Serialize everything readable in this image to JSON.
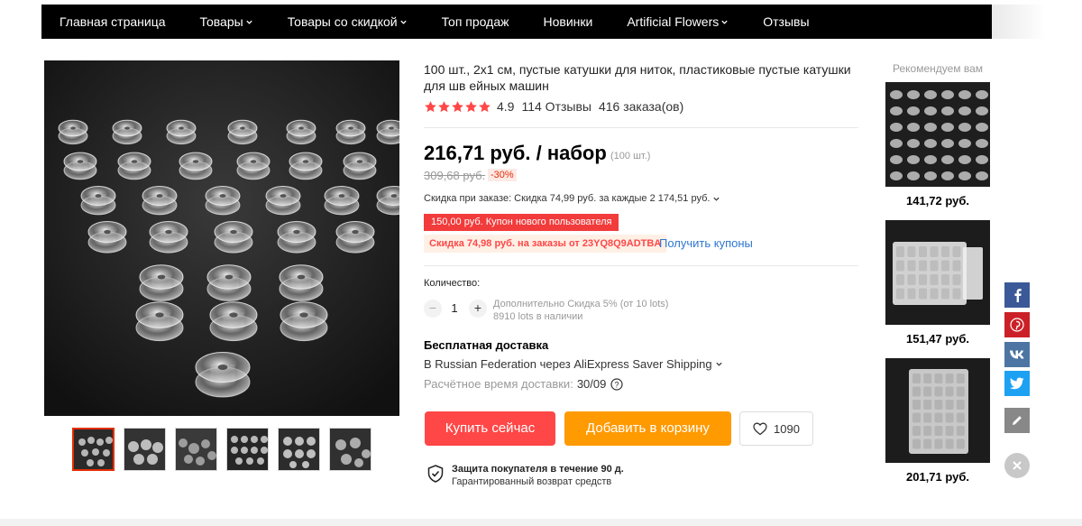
{
  "nav": {
    "items": [
      {
        "label": "Главная страница",
        "has_menu": false
      },
      {
        "label": "Товары",
        "has_menu": true
      },
      {
        "label": "Товары со скидкой",
        "has_menu": true
      },
      {
        "label": "Топ продаж",
        "has_menu": false
      },
      {
        "label": "Новинки",
        "has_menu": false
      },
      {
        "label": "Artificial Flowers",
        "has_menu": true
      },
      {
        "label": "Отзывы",
        "has_menu": false
      }
    ]
  },
  "gallery": {
    "main_alt": "clear-plastic-bobbins",
    "thumbnail_count": 6,
    "active_thumbnail": 1
  },
  "product": {
    "title": "100 шт., 2x1 см, пустые катушки для ниток, пластиковые пустые катушки для шв ейных машин",
    "rating": {
      "stars": 5,
      "score": "4.9",
      "reviews": "114 Отзывы",
      "orders": "416 заказа(ов)"
    },
    "price": "216,71 руб. / набор",
    "unit_note": "(100 шт.)",
    "old_price": "309,68 руб.",
    "discount": "-30%",
    "bulk_discount": "Скидка при заказе: Скидка 74,99 руб. за каждые 2 174,51 руб.",
    "coupon_new_user": "150,00 руб. Купон нового пользователя",
    "coupon_code": "Скидка 74,98 руб. на заказы от 23YQ8Q9ADTBA",
    "get_coupons": "Получить купоны",
    "quantity": {
      "label": "Количество:",
      "minus": "−",
      "value": "1",
      "plus": "+",
      "extra_line1": "Дополнительно Скидка 5% (от 10 lots)",
      "extra_line2": "8910 lots в наличии"
    },
    "shipping": {
      "title": "Бесплатная доставка",
      "to": "В Russian Federation через AliExpress Saver Shipping",
      "time_label": "Расчётное время доставки:",
      "time_value": "30/09"
    },
    "buttons": {
      "buy": "Купить сейчас",
      "cart": "Добавить в корзину",
      "wishlist_count": "1090"
    },
    "protection": {
      "title": "Защита покупателя в течение 90 д.",
      "subtitle": "Гарантированный возврат средств"
    }
  },
  "recommended": {
    "title": "Рекомендуем вам",
    "items": [
      {
        "price": "141,72 руб."
      },
      {
        "price": "151,47 руб."
      },
      {
        "price": "201,71 руб."
      }
    ]
  },
  "social": [
    "facebook-icon",
    "pinterest-icon",
    "vk-icon",
    "twitter-icon",
    "edit-icon",
    "close-icon"
  ],
  "colors": {
    "nav_bg": "#000000",
    "buy": "#ff4747",
    "cart": "#ff9a00",
    "coupon": "#f23b3b",
    "link": "#2e77d0",
    "star": "#ff4747"
  }
}
